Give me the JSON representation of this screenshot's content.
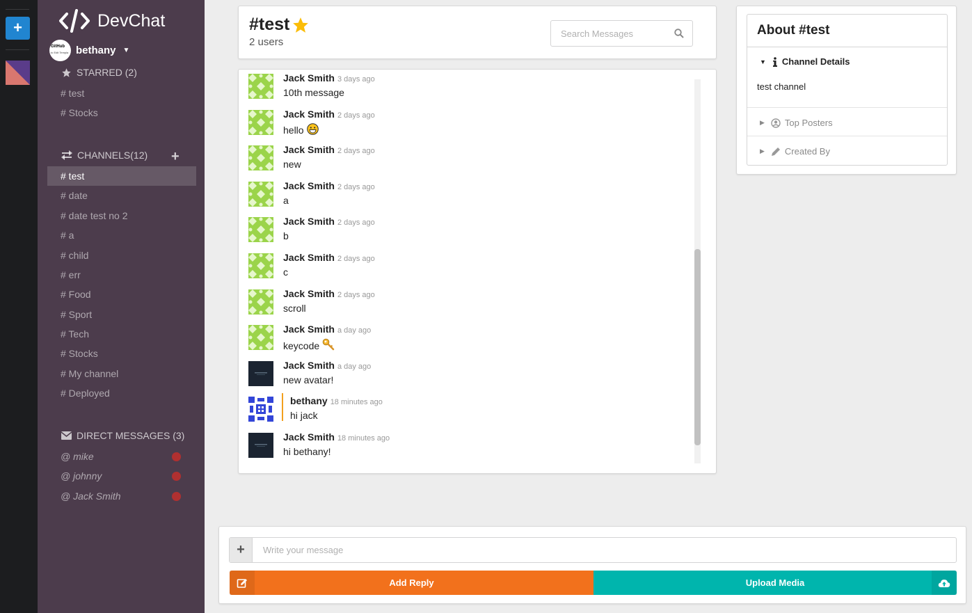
{
  "app": {
    "name": "DevChat"
  },
  "user": {
    "name": "bethany",
    "avatar_text": "GitHub",
    "avatar_subtext": "to Edit Templa"
  },
  "sidebar": {
    "starred": {
      "label": "STARRED (2)",
      "items": [
        "# test",
        "# Stocks"
      ]
    },
    "channels": {
      "label": "CHANNELS(12)",
      "items": [
        "# test",
        "# date",
        "# date test no 2",
        "# a",
        "# child",
        "# err",
        "# Food",
        "# Sport",
        "# Tech",
        "# Stocks",
        "# My channel",
        "# Deployed"
      ],
      "active_index": 0
    },
    "direct": {
      "label": "DIRECT MESSAGES (3)",
      "items": [
        "@ mike",
        "@ johnny",
        "@ Jack Smith"
      ],
      "status_color": "#b03030"
    }
  },
  "header": {
    "channel": "#test",
    "users": "2 users",
    "search_placeholder": "Search Messages"
  },
  "messages": [
    {
      "author": "Jack Smith",
      "time": "3 days ago",
      "text": "10th message",
      "avatar": "green",
      "emoji": ""
    },
    {
      "author": "Jack Smith",
      "time": "2 days ago",
      "text": "hello",
      "avatar": "green",
      "emoji": "grin-emoji"
    },
    {
      "author": "Jack Smith",
      "time": "2 days ago",
      "text": "new",
      "avatar": "green",
      "emoji": ""
    },
    {
      "author": "Jack Smith",
      "time": "2 days ago",
      "text": "a",
      "avatar": "green",
      "emoji": ""
    },
    {
      "author": "Jack Smith",
      "time": "2 days ago",
      "text": "b",
      "avatar": "green",
      "emoji": ""
    },
    {
      "author": "Jack Smith",
      "time": "2 days ago",
      "text": "c",
      "avatar": "green",
      "emoji": ""
    },
    {
      "author": "Jack Smith",
      "time": "2 days ago",
      "text": "scroll",
      "avatar": "green",
      "emoji": ""
    },
    {
      "author": "Jack Smith",
      "time": "a day ago",
      "text": "keycode",
      "avatar": "green",
      "emoji": "key-emoji"
    },
    {
      "author": "Jack Smith",
      "time": "a day ago",
      "text": "new avatar!",
      "avatar": "dark",
      "emoji": ""
    },
    {
      "author": "bethany",
      "time": "18 minutes ago",
      "text": "hi jack",
      "avatar": "blue",
      "emoji": "",
      "own": true
    },
    {
      "author": "Jack Smith",
      "time": "18 minutes ago",
      "text": "hi bethany!",
      "avatar": "dark",
      "emoji": ""
    }
  ],
  "about": {
    "title": "About #test",
    "sections": [
      {
        "label": "Channel Details",
        "open": true,
        "content": "test channel"
      },
      {
        "label": "Top Posters",
        "open": false
      },
      {
        "label": "Created By",
        "open": false
      }
    ]
  },
  "composer": {
    "placeholder": "Write your message",
    "reply_label": "Add Reply",
    "upload_label": "Upload Media"
  },
  "colors": {
    "sidebar": "#4c3c4c",
    "rail": "#1c1d1f",
    "reply": "#f2711c",
    "upload": "#00b5ad",
    "accent": "#2185d0",
    "star": "#fbbd08"
  },
  "scroll": {
    "position_fraction": 0.55
  }
}
